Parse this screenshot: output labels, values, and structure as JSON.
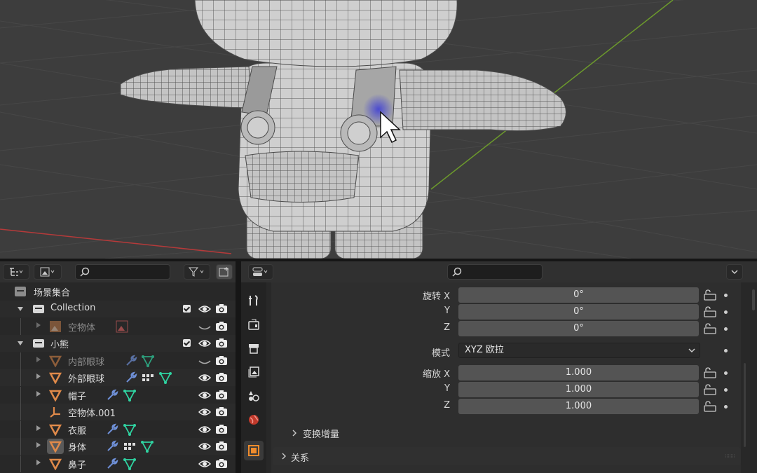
{
  "outliner": {
    "search_placeholder": "",
    "rows": [
      {
        "label": "场景集合",
        "kind": "scene"
      },
      {
        "label": "Collection",
        "kind": "collection",
        "expanded": true
      },
      {
        "label": "空物体",
        "kind": "object",
        "dim": true
      },
      {
        "label": "小熊",
        "kind": "collection",
        "expanded": true
      },
      {
        "label": "内部眼球",
        "kind": "object",
        "dim": true
      },
      {
        "label": "外部眼球",
        "kind": "object"
      },
      {
        "label": "帽子",
        "kind": "object"
      },
      {
        "label": "空物体.001",
        "kind": "empty"
      },
      {
        "label": "衣服",
        "kind": "object"
      },
      {
        "label": "身体",
        "kind": "object",
        "active": true
      },
      {
        "label": "鼻子",
        "kind": "object"
      }
    ]
  },
  "properties": {
    "search_placeholder": "",
    "rotation": {
      "label": "旋转 X",
      "y_label": "Y",
      "z_label": "Z",
      "x": "0°",
      "y": "0°",
      "z": "0°"
    },
    "mode": {
      "label": "模式",
      "value": "XYZ 欧拉"
    },
    "scale": {
      "label": "缩放 X",
      "y_label": "Y",
      "z_label": "Z",
      "x": "1.000",
      "y": "1.000",
      "z": "1.000"
    },
    "delta_transform_label": "变换增量",
    "relations_label": "关系"
  },
  "colors": {
    "viewport_bg": "#3d3d3d",
    "panel_bg": "#282828",
    "mesh_orange": "#e08a4a",
    "modifier_blue": "#6e8fd6",
    "mesh_data_green": "#2fd3a1",
    "active_tab_orange": "#f08c2c",
    "cursor_highlight": "#3a3ad8"
  }
}
